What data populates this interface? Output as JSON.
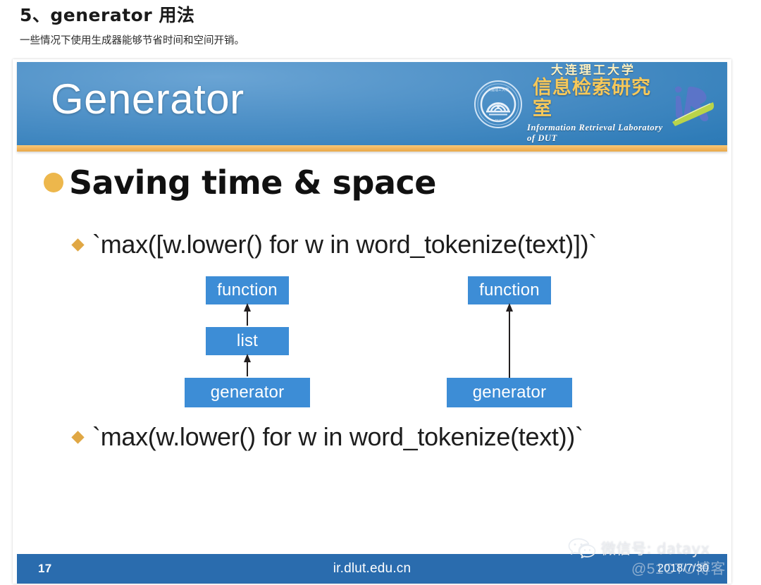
{
  "article": {
    "title": "5、generator 用法",
    "subtitle": "一些情况下使用生成器能够节省时间和空间开销。"
  },
  "slide": {
    "banner": {
      "title": "Generator",
      "logo": {
        "seal_alt": "dlut-seal-icon",
        "cn_small": "大连理工大学",
        "cn_big": "信息检索研究室",
        "en": "Information Retrieval Laboratory of DUT",
        "ir_mark": "IR"
      }
    },
    "bullets": {
      "level1": "Saving time & space",
      "code_line_1": "`max([w.lower() for w in word_tokenize(text)])`",
      "code_line_2": "`max(w.lower() for w in word_tokenize(text))`"
    },
    "diagrams": [
      {
        "name": "list-comprehension-flow",
        "nodes": [
          "generator",
          "list",
          "function"
        ]
      },
      {
        "name": "generator-expression-flow",
        "nodes": [
          "generator",
          "function"
        ]
      }
    ],
    "footer": {
      "page_number": "17",
      "url": "ir.dlut.edu.cn",
      "date": "2018/7/30"
    }
  },
  "watermarks": {
    "wechat": "微信号: datayx",
    "site": "@51CTO博客"
  },
  "colors": {
    "banner_blue": "#3d8dd6",
    "banner_accent": "#f0b35a",
    "node_blue": "#3d8dd6",
    "footer_blue": "#2a6cae",
    "bullet_gold": "#edb74c"
  }
}
